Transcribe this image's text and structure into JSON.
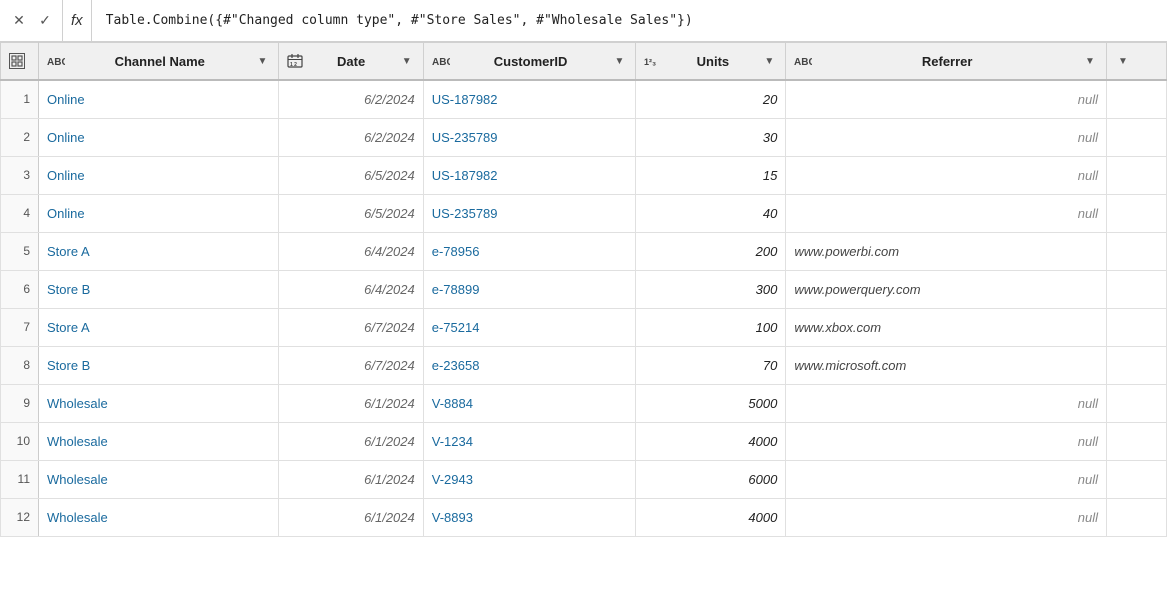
{
  "formula_bar": {
    "formula": "Table.Combine({#\"Changed column type\", #\"Store Sales\", #\"Wholesale Sales\"})",
    "fx_label": "fx",
    "close_icon": "✕",
    "check_icon": "✓"
  },
  "table": {
    "columns": [
      {
        "id": "channel-name",
        "label": "Channel Name",
        "type_icon": "ABC",
        "type": "text",
        "dropdown": true
      },
      {
        "id": "date",
        "label": "Date",
        "type_icon": "🗓",
        "type": "date",
        "dropdown": true
      },
      {
        "id": "customerid",
        "label": "CustomerID",
        "type_icon": "ABC",
        "type": "text",
        "dropdown": true
      },
      {
        "id": "units",
        "label": "Units",
        "type_icon": "123",
        "type": "number",
        "dropdown": true
      },
      {
        "id": "referrer",
        "label": "Referrer",
        "type_icon": "ABC",
        "type": "text",
        "dropdown": true
      }
    ],
    "rows": [
      {
        "num": 1,
        "channel": "Online",
        "date": "6/2/2024",
        "customerid": "US-187982",
        "units": "20",
        "referrer": "null"
      },
      {
        "num": 2,
        "channel": "Online",
        "date": "6/2/2024",
        "customerid": "US-235789",
        "units": "30",
        "referrer": "null"
      },
      {
        "num": 3,
        "channel": "Online",
        "date": "6/5/2024",
        "customerid": "US-187982",
        "units": "15",
        "referrer": "null"
      },
      {
        "num": 4,
        "channel": "Online",
        "date": "6/5/2024",
        "customerid": "US-235789",
        "units": "40",
        "referrer": "null"
      },
      {
        "num": 5,
        "channel": "Store A",
        "date": "6/4/2024",
        "customerid": "e-78956",
        "units": "200",
        "referrer": "www.powerbi.com"
      },
      {
        "num": 6,
        "channel": "Store B",
        "date": "6/4/2024",
        "customerid": "e-78899",
        "units": "300",
        "referrer": "www.powerquery.com"
      },
      {
        "num": 7,
        "channel": "Store A",
        "date": "6/7/2024",
        "customerid": "e-75214",
        "units": "100",
        "referrer": "www.xbox.com"
      },
      {
        "num": 8,
        "channel": "Store B",
        "date": "6/7/2024",
        "customerid": "e-23658",
        "units": "70",
        "referrer": "www.microsoft.com"
      },
      {
        "num": 9,
        "channel": "Wholesale",
        "date": "6/1/2024",
        "customerid": "V-8884",
        "units": "5000",
        "referrer": "null"
      },
      {
        "num": 10,
        "channel": "Wholesale",
        "date": "6/1/2024",
        "customerid": "V-1234",
        "units": "4000",
        "referrer": "null"
      },
      {
        "num": 11,
        "channel": "Wholesale",
        "date": "6/1/2024",
        "customerid": "V-2943",
        "units": "6000",
        "referrer": "null"
      },
      {
        "num": 12,
        "channel": "Wholesale",
        "date": "6/1/2024",
        "customerid": "V-8893",
        "units": "4000",
        "referrer": "null"
      }
    ]
  }
}
